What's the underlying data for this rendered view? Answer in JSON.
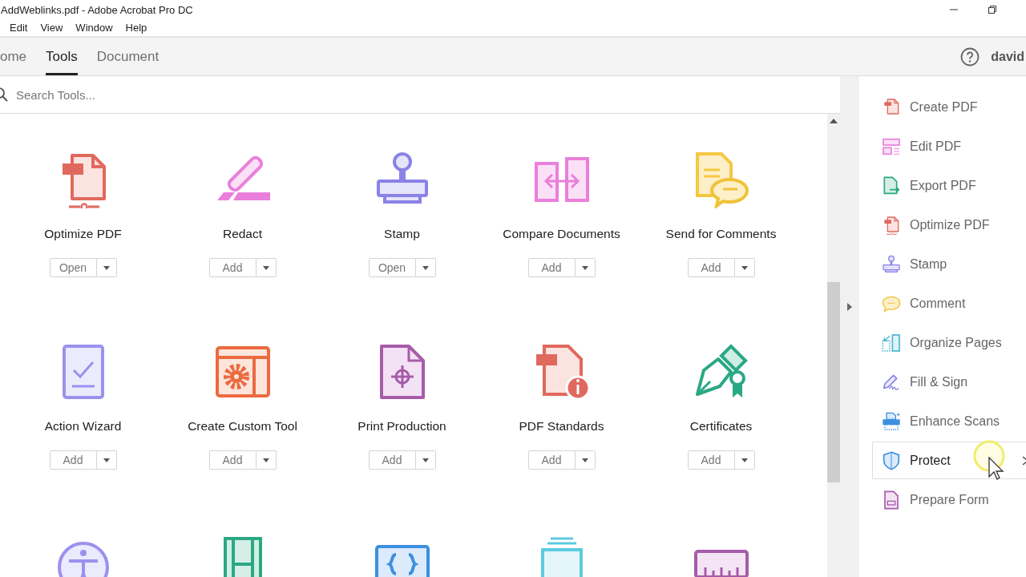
{
  "window": {
    "title": "AddWeblinks.pdf - Adobe Acrobat Pro DC"
  },
  "menu": [
    "Edit",
    "View",
    "Window",
    "Help"
  ],
  "tabs": [
    {
      "label": "ome",
      "selected": false
    },
    {
      "label": "Tools",
      "selected": true
    },
    {
      "label": "Document",
      "selected": false
    }
  ],
  "user": "david",
  "search": {
    "placeholder": "Search Tools..."
  },
  "tools": [
    {
      "kind": "optimize",
      "name": "Optimize PDF",
      "button": "Open"
    },
    {
      "kind": "redact",
      "name": "Redact",
      "button": "Add"
    },
    {
      "kind": "stamp",
      "name": "Stamp",
      "button": "Open"
    },
    {
      "kind": "compare",
      "name": "Compare Documents",
      "button": "Add"
    },
    {
      "kind": "comments",
      "name": "Send for Comments",
      "button": "Add"
    },
    {
      "kind": "wizard",
      "name": "Action Wizard",
      "button": "Add"
    },
    {
      "kind": "custom",
      "name": "Create Custom Tool",
      "button": "Add"
    },
    {
      "kind": "print",
      "name": "Print Production",
      "button": "Add"
    },
    {
      "kind": "standards",
      "name": "PDF Standards",
      "button": "Add"
    },
    {
      "kind": "certificates",
      "name": "Certificates",
      "button": "Add"
    },
    {
      "kind": "accessibility"
    },
    {
      "kind": "media"
    },
    {
      "kind": "javascript"
    },
    {
      "kind": "index"
    },
    {
      "kind": "measure"
    }
  ],
  "sidebar": [
    {
      "kind": "create",
      "label": "Create PDF",
      "selected": false
    },
    {
      "kind": "edit",
      "label": "Edit PDF",
      "selected": false
    },
    {
      "kind": "export",
      "label": "Export PDF",
      "selected": false
    },
    {
      "kind": "optimize",
      "label": "Optimize PDF",
      "selected": false
    },
    {
      "kind": "stamp",
      "label": "Stamp",
      "selected": false
    },
    {
      "kind": "comment",
      "label": "Comment",
      "selected": false
    },
    {
      "kind": "organize",
      "label": "Organize Pages",
      "selected": false
    },
    {
      "kind": "fillsign",
      "label": "Fill & Sign",
      "selected": false
    },
    {
      "kind": "enhance",
      "label": "Enhance Scans",
      "selected": false
    },
    {
      "kind": "protect",
      "label": "Protect",
      "selected": true
    },
    {
      "kind": "form",
      "label": "Prepare Form",
      "selected": false
    }
  ]
}
